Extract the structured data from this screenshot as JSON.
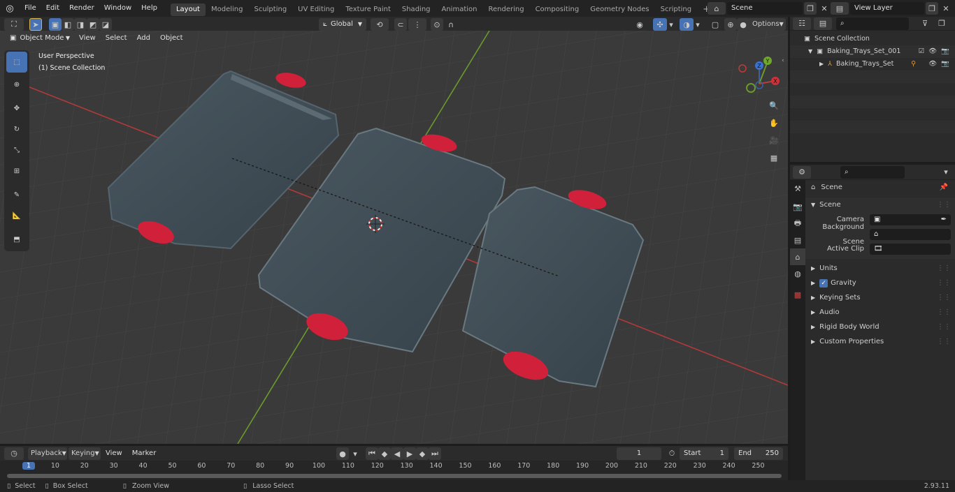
{
  "topbar": {
    "menus": [
      "File",
      "Edit",
      "Render",
      "Window",
      "Help"
    ],
    "workspaces": [
      "Layout",
      "Modeling",
      "Sculpting",
      "UV Editing",
      "Texture Paint",
      "Shading",
      "Animation",
      "Rendering",
      "Compositing",
      "Geometry Nodes",
      "Scripting"
    ],
    "active_workspace": "Layout",
    "add_tab": "+",
    "scene": "Scene",
    "view_layer": "View Layer"
  },
  "viewport": {
    "mode": "Object Mode",
    "menus": [
      "View",
      "Select",
      "Add",
      "Object"
    ],
    "transform_orientation": "Global",
    "options": "Options",
    "overlay_line1": "User Perspective",
    "overlay_line2": "(1) Scene Collection",
    "gizmo": {
      "z": "Z",
      "y": "Y",
      "x": "X"
    }
  },
  "outliner": {
    "root": "Scene Collection",
    "collection": "Baking_Trays_Set_001",
    "object": "Baking_Trays_Set"
  },
  "properties": {
    "context": "Scene",
    "panel": "Scene",
    "camera_label": "Camera",
    "background_label": "Background Scene",
    "clip_label": "Active Clip",
    "sections": [
      "Units",
      "Gravity",
      "Keying Sets",
      "Audio",
      "Rigid Body World",
      "Custom Properties"
    ],
    "gravity_checked": true
  },
  "timeline": {
    "menus": [
      "Playback",
      "Keying",
      "View",
      "Marker"
    ],
    "current_frame": "1",
    "start_label": "Start",
    "start_value": "1",
    "end_label": "End",
    "end_value": "250",
    "ticks": [
      "1",
      "10",
      "20",
      "30",
      "40",
      "50",
      "60",
      "70",
      "80",
      "90",
      "100",
      "110",
      "120",
      "130",
      "140",
      "150",
      "160",
      "170",
      "180",
      "190",
      "200",
      "210",
      "220",
      "230",
      "240",
      "250"
    ]
  },
  "status": {
    "select": "Select",
    "box_select": "Box Select",
    "zoom_view": "Zoom View",
    "lasso_select": "Lasso Select",
    "version": "2.93.11"
  },
  "colors": {
    "accent": "#4772b3",
    "handle": "#d0203a",
    "tray": "#3e4a52",
    "x_axis": "#c03a3a",
    "y_axis": "#6b9a2a"
  }
}
